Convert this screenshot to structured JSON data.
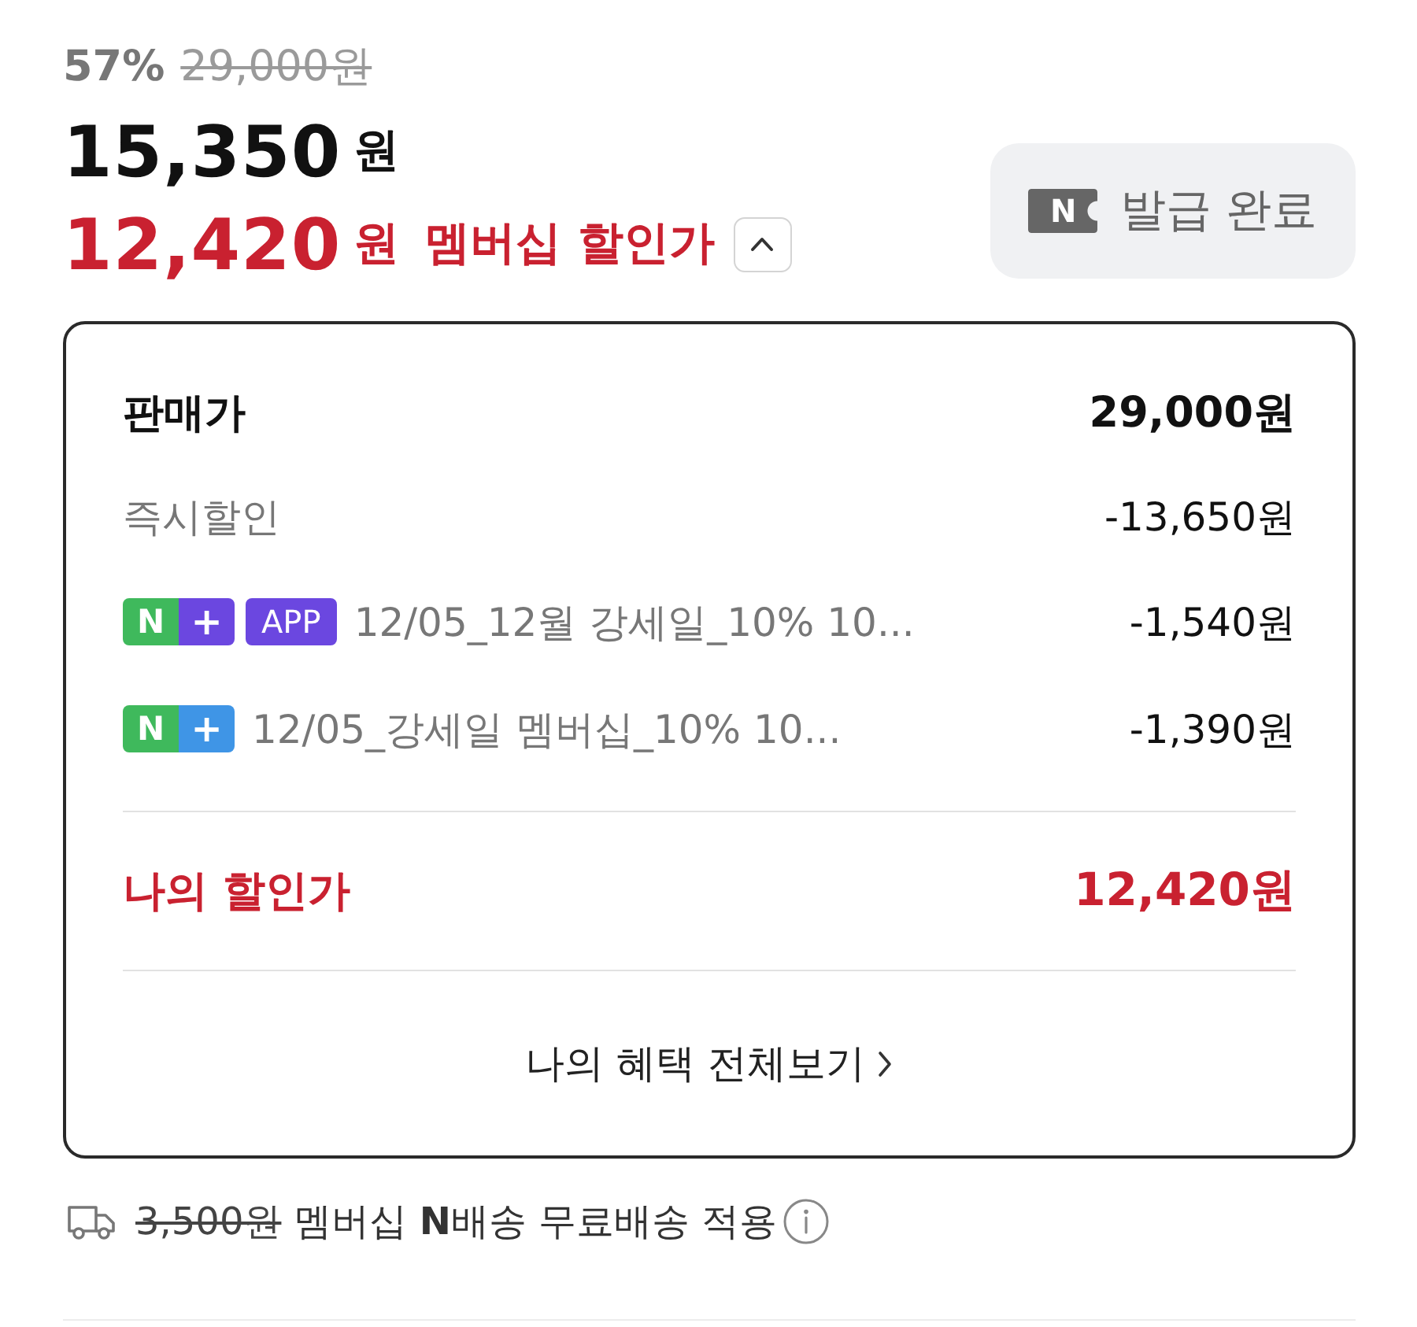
{
  "price": {
    "discount_rate": "57%",
    "original_price": "29,000원",
    "sale_amount": "15,350",
    "sale_unit": "원",
    "member_amount": "12,420",
    "member_unit": "원",
    "member_label": "멤버십 할인가",
    "expanded": true
  },
  "coupon_button": {
    "icon_letter": "N",
    "label": "발급 완료"
  },
  "breakdown": {
    "rows": [
      {
        "kind": "total",
        "label": "판매가",
        "value": "29,000원"
      },
      {
        "kind": "discount",
        "label": "즉시할인",
        "value": "-13,650원"
      },
      {
        "kind": "coupon",
        "badges": [
          {
            "kind": "nplus",
            "left": "N",
            "right": "+",
            "color": "#6b47e0"
          },
          {
            "kind": "tag",
            "label": "APP",
            "color": "#6b47e0"
          }
        ],
        "label": "12/05_12월 강세일_10% 10...",
        "value": "-1,540원"
      },
      {
        "kind": "coupon",
        "badges": [
          {
            "kind": "nplus",
            "left": "N",
            "right": "+",
            "color": "#3f95e6"
          }
        ],
        "label": "12/05_강세일 멤버십_10% 10...",
        "value": "-1,390원"
      }
    ],
    "final": {
      "label": "나의 할인가",
      "value": "12,420원"
    },
    "link": {
      "label": "나의 혜택 전체보기"
    }
  },
  "delivery": {
    "original_fee": "3,500원",
    "text": "멤버십 **N**배송 무료배송 적용"
  }
}
